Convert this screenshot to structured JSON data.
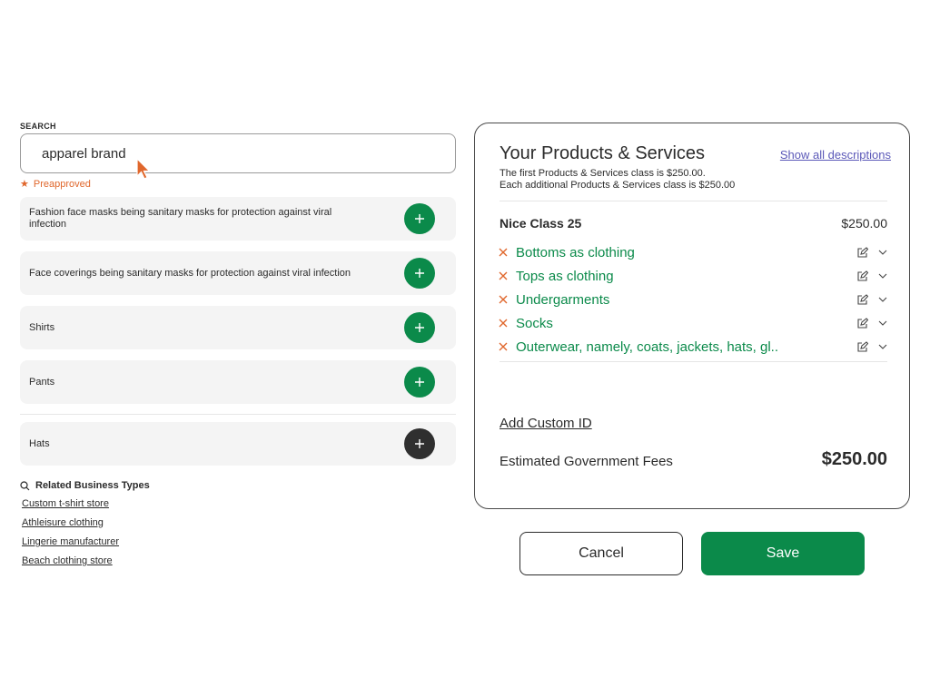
{
  "search": {
    "label": "SEARCH",
    "value": "apparel brand",
    "preapproved": "Preapproved"
  },
  "results": [
    {
      "text": "Fashion face masks being sanitary masks for protection against viral infection",
      "button": "add-dark-green"
    },
    {
      "text": "Face coverings being sanitary masks for protection against viral infection",
      "button": "add-green"
    },
    {
      "text": "Shirts",
      "button": "add-green"
    },
    {
      "text": "Pants",
      "button": "add-green"
    },
    {
      "text": "Hats",
      "button": "add-dark"
    }
  ],
  "related": {
    "title": "Related Business Types",
    "links": [
      "Custom t-shirt store",
      "Athleisure clothing",
      "Lingerie manufacturer",
      "Beach clothing store"
    ]
  },
  "panel": {
    "title": "Your Products & Services",
    "show_all": "Show all descriptions",
    "sub1": "The first Products & Services class is $250.00.",
    "sub2": "Each additional Products & Services class is $250.00",
    "class_name": "Nice Class 25",
    "class_price": "$250.00",
    "items": [
      "Bottoms as clothing",
      "Tops as clothing",
      "Undergarments",
      "Socks",
      "Outerwear, namely, coats, jackets, hats, gl.."
    ],
    "add_custom": "Add Custom ID",
    "fees_label": "Estimated Government Fees",
    "fees_value": "$250.00"
  },
  "buttons": {
    "cancel": "Cancel",
    "save": "Save"
  },
  "colors": {
    "accent_green": "#0b8a4a",
    "orange": "#e0672c",
    "link_purple": "#5b58b8"
  }
}
